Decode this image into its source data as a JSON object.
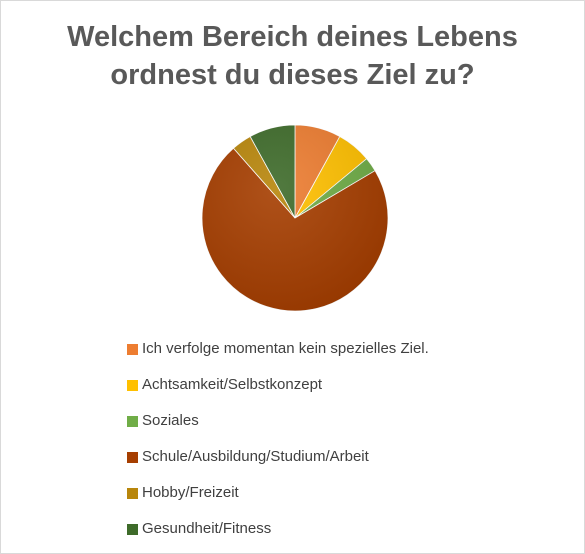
{
  "chart_data": {
    "type": "pie",
    "title": "Welchem Bereich deines Lebens ordnest du dieses Ziel zu?",
    "title_lines": [
      "Welchem Bereich deines Lebens",
      "ordnest du dieses Ziel zu?"
    ],
    "legend_position": "bottom",
    "start_angle_deg": 0,
    "direction": "clockwise",
    "slices": [
      {
        "label": "Ich verfolge momentan kein spezielles Ziel.",
        "value": 8,
        "color": "#ED7D31"
      },
      {
        "label": "Achtsamkeit/Selbstkonzept",
        "value": 6,
        "color": "#FFC000"
      },
      {
        "label": "Soziales",
        "value": 2.5,
        "color": "#70AD47"
      },
      {
        "label": "Schule/Ausbildung/Studium/Arbeit",
        "value": 72,
        "color": "#A63E00"
      },
      {
        "label": "Hobby/Freizeit",
        "value": 3.5,
        "color": "#B8860B"
      },
      {
        "label": "Gesundheit/Fitness",
        "value": 8,
        "color": "#3E6B2A"
      }
    ]
  }
}
